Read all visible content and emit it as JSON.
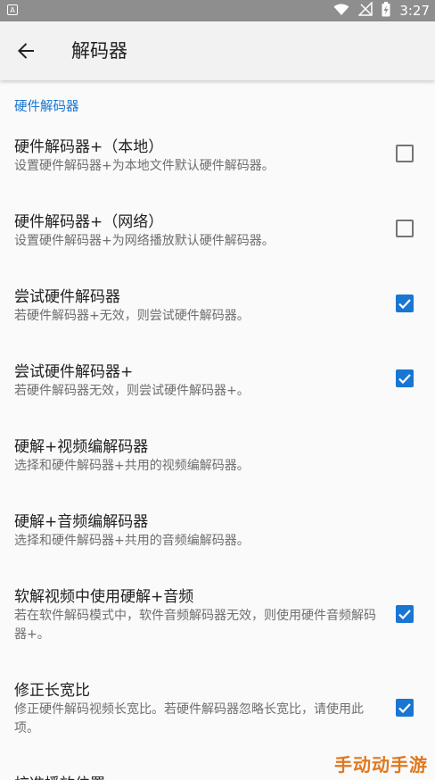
{
  "status_bar": {
    "notification_badge": "A",
    "time": "3:27",
    "icons": [
      "wifi-icon",
      "no-signal-icon",
      "battery-charging-icon"
    ]
  },
  "app_bar": {
    "title": "解码器",
    "back_icon": "arrow-back-icon"
  },
  "category": "硬件解码器",
  "preferences": [
    {
      "title": "硬件解码器+（本地）",
      "summary": "设置硬件解码器+为本地文件默认硬件解码器。",
      "checkbox": false
    },
    {
      "title": "硬件解码器+（网络）",
      "summary": "设置硬件解码器+为网络播放默认硬件解码器。",
      "checkbox": false
    },
    {
      "title": "尝试硬件解码器",
      "summary": "若硬件解码器+无效，则尝试硬件解码器。",
      "checkbox": true
    },
    {
      "title": "尝试硬件解码器+",
      "summary": "若硬件解码器无效，则尝试硬件解码器+。",
      "checkbox": true
    },
    {
      "title": "硬解+视频编解码器",
      "summary": "选择和硬件解码器+共用的视频编解码器。",
      "checkbox": null
    },
    {
      "title": "硬解+音频编解码器",
      "summary": "选择和硬件解码器+共用的音频编解码器。",
      "checkbox": null
    },
    {
      "title": "软解视频中使用硬解+音频",
      "summary": "若在软件解码模式中，软件音频解码器无效，则使用硬件音频解码器+。",
      "checkbox": true
    },
    {
      "title": "修正长宽比",
      "summary": "修正硬件解码视频长宽比。若硬件解码器忽略长宽比，请使用此项。",
      "checkbox": true
    },
    {
      "title": "校准播放位置",
      "summary": "",
      "checkbox": null
    }
  ],
  "watermark": "手动动手游",
  "colors": {
    "accent": "#1976d2",
    "status_bar": "#8e8e8e",
    "app_bar": "#f2f2f2"
  }
}
